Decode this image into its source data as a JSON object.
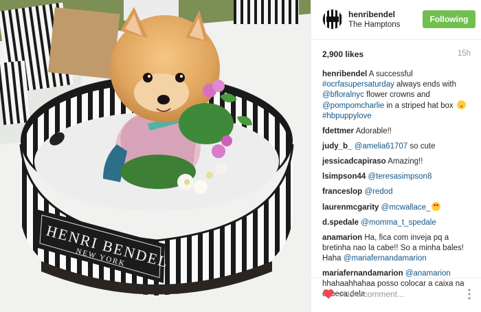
{
  "post": {
    "username": "henribendel",
    "location": "The Hamptons",
    "follow_label": "Following",
    "likes": "2,900 likes",
    "time": "15h",
    "caption": {
      "user": "henribendel",
      "text1": " A successful ",
      "tag1": "#ocrfasupersaturday",
      "text2": " always ends with ",
      "mention1": "@bfloralnyc",
      "text3": " flower crowns and ",
      "mention2": "@pompomcharlie",
      "text4": " in a striped hat box ",
      "tag2": "#hbpuppylove"
    },
    "photo": {
      "box_brand": "HENRI BENDEL",
      "box_city": "NEW YORK"
    }
  },
  "comments": [
    {
      "user": "fdettmer",
      "text": " Adorable!!"
    },
    {
      "user": "judy_b_",
      "mention": "@amelia61707",
      "text": " so cute"
    },
    {
      "user": "jessicadcapiraso",
      "text": " Amazing!!"
    },
    {
      "user": "lsimpson44",
      "mention": "@teresasimpson8"
    },
    {
      "user": "franceslop",
      "mention": "@redod"
    },
    {
      "user": "laurenmcgarity",
      "mention": "@mcwallace_"
    },
    {
      "user": "d.spedale",
      "mention": "@momma_t_spedale"
    },
    {
      "user": "anamarion",
      "text": " Ha, fica com inveja pq a bretinha nao la cabe!! So a minha bales! Haha ",
      "mention": "@mariafernandamarion"
    },
    {
      "user": "mariafernandamarion",
      "mention": "@anamarion",
      "text": " hhahaahhahaa posso colocar a caixa na cabeca dela"
    }
  ],
  "add_comment": {
    "placeholder": "Add a comment..."
  },
  "icons": {
    "like": "heart-icon",
    "options": "more-options-icon",
    "avatar": "henri-bendel-logo"
  },
  "colors": {
    "follow_button": "#70c050",
    "link": "#125688",
    "heart": "#ed4956"
  }
}
